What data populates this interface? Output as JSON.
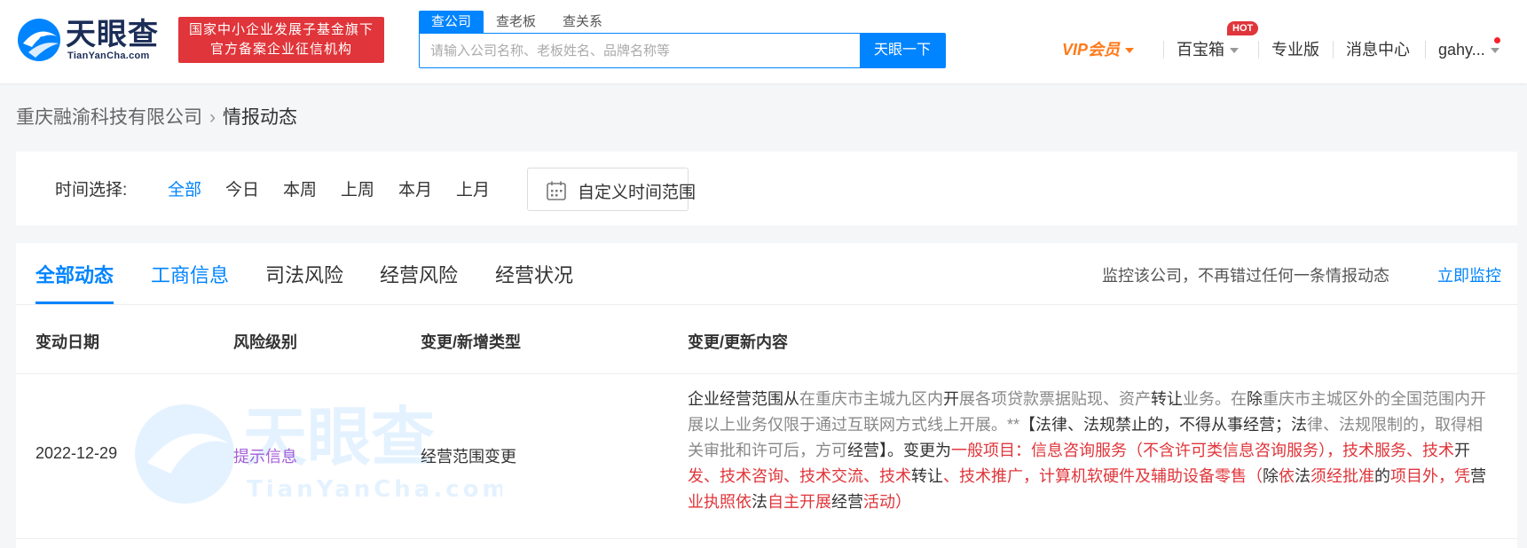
{
  "header": {
    "logo_cn": "天眼查",
    "logo_en": "TianYanCha.com",
    "badge_line1": "国家中小企业发展子基金旗下",
    "badge_line2": "官方备案企业征信机构",
    "search_tabs": [
      "查公司",
      "查老板",
      "查关系"
    ],
    "search_placeholder": "请输入公司名称、老板姓名、品牌名称等",
    "search_button": "天眼一下",
    "vip_label": "VIP会员",
    "baobaoxiang": "百宝箱",
    "hot_badge": "HOT",
    "pro": "专业版",
    "messages": "消息中心",
    "user": "gahy..."
  },
  "breadcrumb": {
    "company": "重庆融渝科技有限公司",
    "current": "情报动态"
  },
  "time_filter": {
    "label": "时间选择:",
    "options": [
      "全部",
      "今日",
      "本周",
      "上周",
      "本月",
      "上月"
    ],
    "active_index": 0,
    "custom_label": "自定义时间范围"
  },
  "tabs": {
    "items": [
      "全部动态",
      "工商信息",
      "司法风险",
      "经营风险",
      "经营状况"
    ],
    "active_index": 0,
    "monitor_text": "监控该公司，不再错过任何一条情报动态",
    "monitor_link": "立即监控"
  },
  "table": {
    "headers": [
      "变动日期",
      "风险级别",
      "变更/新增类型",
      "变更/更新内容"
    ],
    "rows": [
      {
        "date": "2022-12-29",
        "risk": "提示信息",
        "type": "经营范围变更",
        "content_parts": [
          {
            "t": "企业经营范围从",
            "c": "n"
          },
          {
            "t": "在重庆市主城九区内",
            "c": "g"
          },
          {
            "t": "开",
            "c": "n"
          },
          {
            "t": "展各项贷款票据贴现、资产",
            "c": "g"
          },
          {
            "t": "转让",
            "c": "n"
          },
          {
            "t": "业务。在",
            "c": "g"
          },
          {
            "t": "除",
            "c": "n"
          },
          {
            "t": "重庆市主城区外的全国范围内开展以上业务仅限于通过互联网方式线上开展。**",
            "c": "g"
          },
          {
            "t": "【法律、法规禁止的，不得从事经营；法",
            "c": "n"
          },
          {
            "t": "律、法规限制的，取得相关审批和许可后，方可",
            "c": "g"
          },
          {
            "t": "经营",
            "c": "n"
          },
          {
            "t": "】。变更为",
            "c": "n"
          },
          {
            "t": "一般项目：信息咨询服务（不含许可类信息咨询服务），技术服务、技术",
            "c": "r"
          },
          {
            "t": "开",
            "c": "n"
          },
          {
            "t": "发、技术咨询、技术交流、技术",
            "c": "r"
          },
          {
            "t": "转让",
            "c": "n"
          },
          {
            "t": "、技术推广，计算机软硬件及辅助设备零售（",
            "c": "r"
          },
          {
            "t": "除",
            "c": "n"
          },
          {
            "t": "依",
            "c": "r"
          },
          {
            "t": "法",
            "c": "n"
          },
          {
            "t": "须经批准",
            "c": "r"
          },
          {
            "t": "的",
            "c": "n"
          },
          {
            "t": "项目外，",
            "c": "r"
          },
          {
            "t": "凭",
            "c": "r"
          },
          {
            "t": "营",
            "c": "n"
          },
          {
            "t": "业执照依",
            "c": "r"
          },
          {
            "t": "法",
            "c": "n"
          },
          {
            "t": "自主开展",
            "c": "r"
          },
          {
            "t": "经营",
            "c": "n"
          },
          {
            "t": "活动）",
            "c": "r"
          }
        ]
      }
    ]
  },
  "colors": {
    "primary": "#0084ff",
    "brand_red": "#e0353a",
    "vip_orange": "#ff7a1a",
    "risk_purple": "#a55ed8"
  }
}
